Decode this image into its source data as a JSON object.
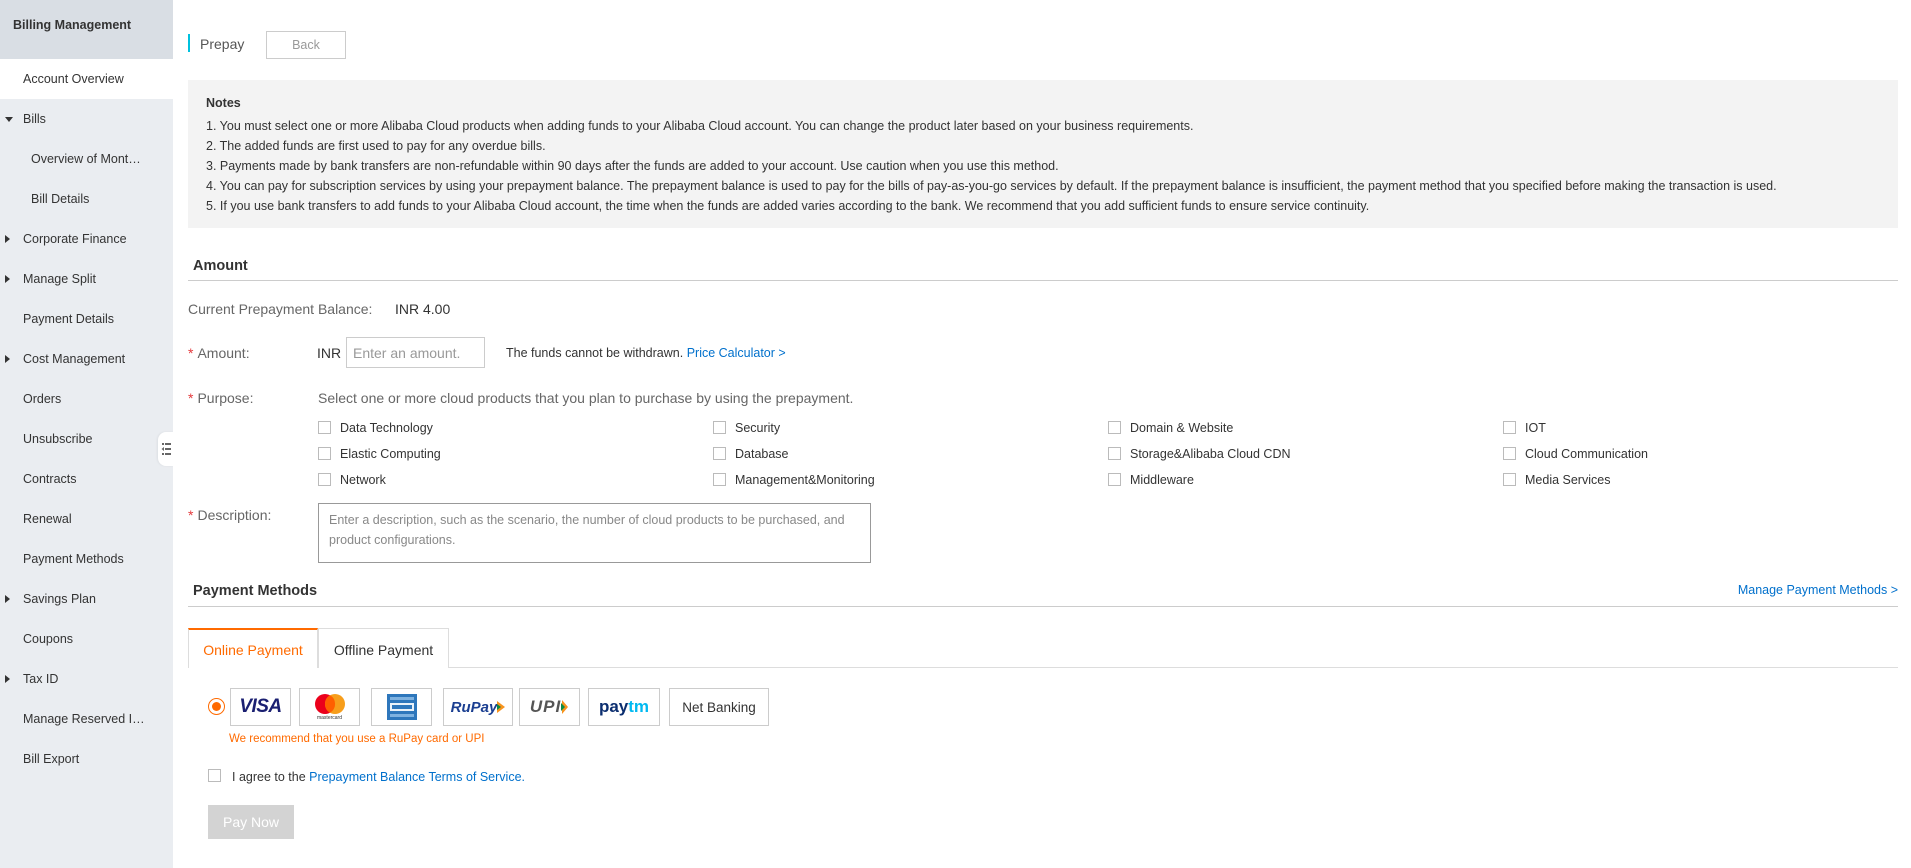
{
  "sidebar": {
    "title": "Billing Management",
    "items": [
      {
        "label": "Account Overview"
      },
      {
        "label": "Bills"
      },
      {
        "label": "Overview of Mont…"
      },
      {
        "label": "Bill Details"
      },
      {
        "label": "Corporate Finance"
      },
      {
        "label": "Manage Split"
      },
      {
        "label": "Payment Details"
      },
      {
        "label": "Cost Management"
      },
      {
        "label": "Orders"
      },
      {
        "label": "Unsubscribe"
      },
      {
        "label": "Contracts"
      },
      {
        "label": "Renewal"
      },
      {
        "label": "Payment Methods"
      },
      {
        "label": "Savings Plan"
      },
      {
        "label": "Coupons"
      },
      {
        "label": "Tax ID"
      },
      {
        "label": "Manage Reserved I…"
      },
      {
        "label": "Bill Export"
      }
    ]
  },
  "header": {
    "title": "Prepay",
    "back_label": "Back"
  },
  "notes": {
    "title": "Notes",
    "lines": [
      "1. You must select one or more Alibaba Cloud products when adding funds to your Alibaba Cloud account. You can change the product later based on your business requirements.",
      "2. The added funds are first used to pay for any overdue bills.",
      "3. Payments made by bank transfers are non-refundable within 90 days after the funds are added to your account. Use caution when you use this method.",
      "4. You can pay for subscription services by using your prepayment balance. The prepayment balance is used to pay for the bills of pay-as-you-go services by default. If the prepayment balance is insufficient, the payment method that you specified before making the transaction is used.",
      "5. If you use bank transfers to add funds to your Alibaba Cloud account, the time when the funds are added varies according to the bank. We recommend that you add sufficient funds to ensure service continuity."
    ]
  },
  "amount_section": {
    "heading": "Amount",
    "balance_label": "Current Prepayment Balance:",
    "balance_value": "INR 4.00",
    "amount_label": "Amount:",
    "currency": "INR",
    "amount_placeholder": "Enter an amount.",
    "amount_value": "",
    "funds_note": "The funds cannot be withdrawn.",
    "price_calculator_label": "Price Calculator >",
    "purpose_label": "Purpose:",
    "purpose_hint": "Select one or more cloud products that you plan to purchase by using the prepayment.",
    "products": [
      {
        "label": "Data Technology",
        "checked": false
      },
      {
        "label": "Security",
        "checked": false
      },
      {
        "label": "Domain & Website",
        "checked": false
      },
      {
        "label": "IOT",
        "checked": false
      },
      {
        "label": "Elastic Computing",
        "checked": false
      },
      {
        "label": "Database",
        "checked": false
      },
      {
        "label": "Storage&Alibaba Cloud CDN",
        "checked": false
      },
      {
        "label": "Cloud Communication",
        "checked": false
      },
      {
        "label": "Network",
        "checked": false
      },
      {
        "label": "Management&Monitoring",
        "checked": false
      },
      {
        "label": "Middleware",
        "checked": false
      },
      {
        "label": "Media Services",
        "checked": false
      }
    ],
    "description_label": "Description:",
    "description_placeholder": "Enter a description, such as the scenario, the number of cloud products to be purchased, and product configurations."
  },
  "payment_section": {
    "heading": "Payment Methods",
    "manage_link": "Manage Payment Methods >",
    "tabs": [
      {
        "label": "Online Payment",
        "active": true
      },
      {
        "label": "Offline Payment",
        "active": false
      }
    ],
    "methods": {
      "visa": "VISA",
      "mastercard_caption": "mastercard",
      "rupay": "RuPay",
      "upi": "UPI",
      "paytm_pay": "pay",
      "paytm_tm": "tm",
      "net_banking": "Net Banking"
    },
    "recommend_text": "We recommend that you use a RuPay card or UPI",
    "agree_prefix": "I agree to the",
    "agree_link": "Prepayment Balance Terms of Service.",
    "pay_button": "Pay Now"
  },
  "colors": {
    "accent_orange": "#ff6a00",
    "link_blue": "#0070cc",
    "title_bar_cyan": "#00c1de",
    "required_red": "#e4393c",
    "sidebar_bg": "#eaedf1"
  }
}
